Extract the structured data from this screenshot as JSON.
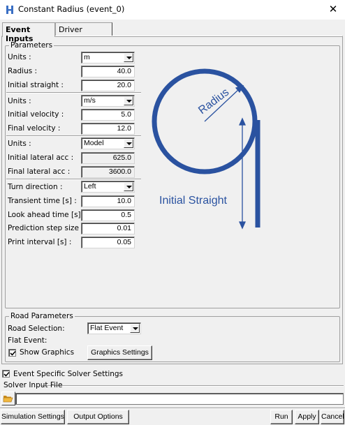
{
  "window": {
    "title": "Constant Radius (event_0)",
    "close_glyph": "✕"
  },
  "tabs": [
    {
      "label": "Event Inputs",
      "active": true
    },
    {
      "label": "Driver",
      "active": false
    }
  ],
  "parameters": {
    "legend": "Parameters",
    "units1": {
      "label": "Units :",
      "value": "m"
    },
    "radius": {
      "label": "Radius :",
      "value": "40.0"
    },
    "initial_straight": {
      "label": "Initial straight :",
      "value": "20.0"
    },
    "units2": {
      "label": "Units :",
      "value": "m/s"
    },
    "initial_velocity": {
      "label": "Initial velocity :",
      "value": "5.0"
    },
    "final_velocity": {
      "label": "Final velocity :",
      "value": "12.0"
    },
    "units3": {
      "label": "Units :",
      "value": "Model"
    },
    "initial_lateral_acc": {
      "label": "Initial lateral acc :",
      "value": "625.0"
    },
    "final_lateral_acc": {
      "label": "Final lateral acc :",
      "value": "3600.0"
    },
    "turn_direction": {
      "label": "Turn direction  :",
      "value": "Left"
    },
    "transient_time": {
      "label": "Transient time [s] :",
      "value": "10.0"
    },
    "look_ahead_time": {
      "label": "Look ahead time [s] :",
      "value": "0.5"
    },
    "prediction_step_size": {
      "label": "Prediction step size [s] :",
      "value": "0.01"
    },
    "print_interval": {
      "label": "Print interval [s] :",
      "value": "0.05"
    }
  },
  "diagram": {
    "radius_label": "Radius",
    "straight_label": "Initial Straight",
    "color": "#2a52a0"
  },
  "road": {
    "legend": "Road Parameters",
    "selection_label": "Road Selection:",
    "selection_value": "Flat Event",
    "flat_event_label": "Flat Event:",
    "show_graphics_label": "Show Graphics",
    "show_graphics_checked": true,
    "graphics_settings_button": "Graphics Settings"
  },
  "solver": {
    "event_specific_label": "Event Specific Solver Settings",
    "event_specific_checked": true,
    "input_file_legend": "Solver Input File",
    "input_file_value": ""
  },
  "footer": {
    "simulation_settings": "Simulation Settings",
    "output_options": "Output Options",
    "run": "Run",
    "apply": "Apply",
    "cancel": "Cancel"
  },
  "icons": {
    "app": "app-logo-icon",
    "folder": "open-folder-icon"
  }
}
